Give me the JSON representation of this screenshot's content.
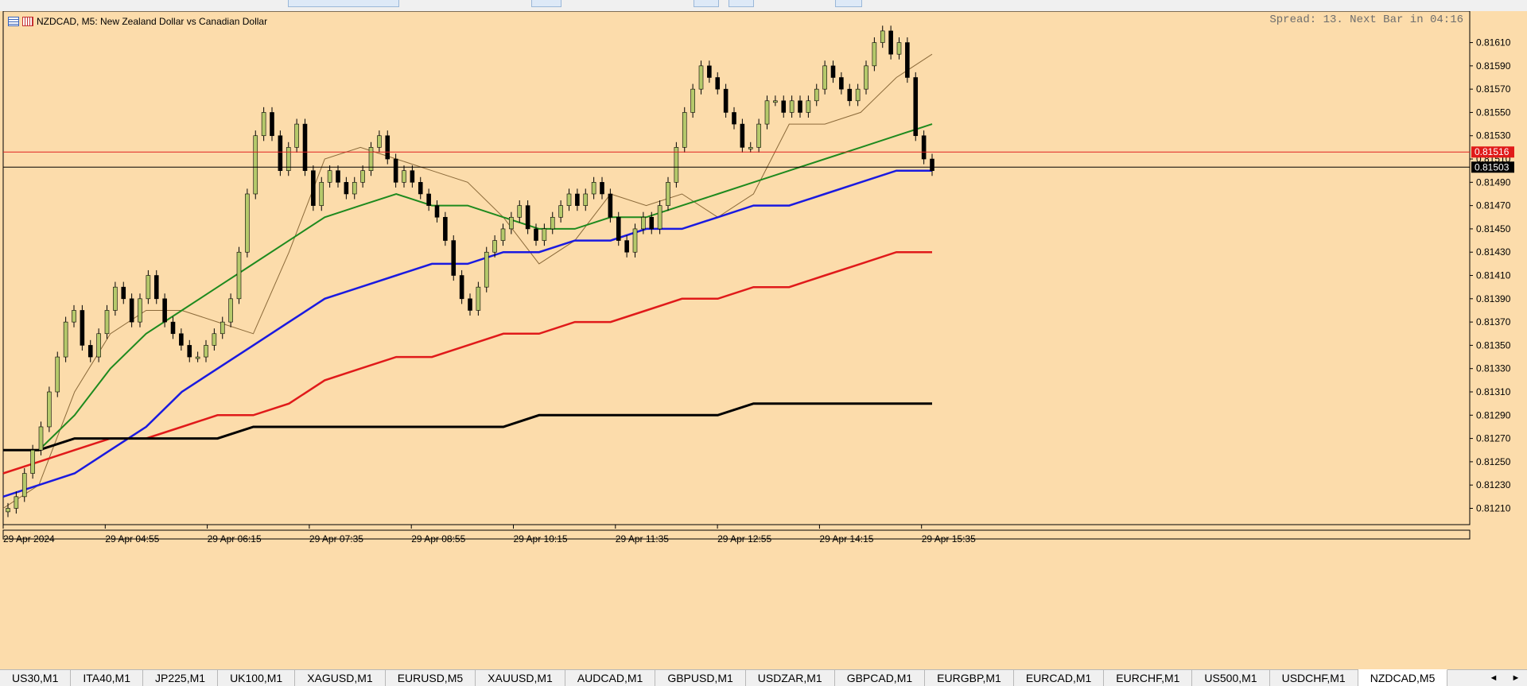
{
  "window": {
    "symbol_title": "NZDCAD, M5:  New Zealand Dollar vs Canadian Dollar",
    "spread_text": "Spread: 13. Next Bar in 04:16"
  },
  "icons": [
    "list-icon",
    "bar-chart-icon",
    "scroll-left-icon",
    "scroll-right-icon"
  ],
  "colors": {
    "chart_background": "#fcdcab",
    "bull_candle": "#b5c96b",
    "bear_candle": "#000000",
    "ask_line": "#e02020",
    "bid_line": "#000000"
  },
  "chart_data": {
    "type": "candlestick",
    "symbol": "NZDCAD",
    "timeframe": "M5",
    "x_ticks": [
      "29 Apr 2024",
      "29 Apr 04:55",
      "29 Apr 06:15",
      "29 Apr 07:35",
      "29 Apr 08:55",
      "29 Apr 10:15",
      "29 Apr 11:35",
      "29 Apr 12:55",
      "29 Apr 14:15",
      "29 Apr 15:35"
    ],
    "y_ticks": [
      "0.81610",
      "0.81590",
      "0.81570",
      "0.81550",
      "0.81530",
      "0.81510",
      "0.81490",
      "0.81470",
      "0.81450",
      "0.81430",
      "0.81410",
      "0.81390",
      "0.81370",
      "0.81350",
      "0.81330",
      "0.81310",
      "0.81290",
      "0.81270",
      "0.81250",
      "0.81230",
      "0.81210"
    ],
    "ylim": [
      0.81196,
      0.81637
    ],
    "ask_price": "0.81516",
    "bid_price": "0.81503",
    "closes": [
      0.8121,
      0.8122,
      0.8124,
      0.8126,
      0.8128,
      0.8131,
      0.8134,
      0.8137,
      0.8138,
      0.8135,
      0.8134,
      0.8136,
      0.8138,
      0.814,
      0.8139,
      0.8137,
      0.8139,
      0.8141,
      0.8139,
      0.8137,
      0.8136,
      0.8135,
      0.8134,
      0.8134,
      0.8135,
      0.8136,
      0.8137,
      0.8139,
      0.8143,
      0.8148,
      0.8153,
      0.8155,
      0.8153,
      0.815,
      0.8152,
      0.8154,
      0.815,
      0.8147,
      0.8149,
      0.815,
      0.8149,
      0.8148,
      0.8149,
      0.815,
      0.8152,
      0.8153,
      0.8151,
      0.8149,
      0.815,
      0.8149,
      0.8148,
      0.8147,
      0.8146,
      0.8144,
      0.8141,
      0.8139,
      0.8138,
      0.814,
      0.8143,
      0.8144,
      0.8145,
      0.8146,
      0.8147,
      0.8145,
      0.8144,
      0.8145,
      0.8146,
      0.8147,
      0.8148,
      0.8147,
      0.8148,
      0.8149,
      0.8148,
      0.8146,
      0.8144,
      0.8143,
      0.8145,
      0.8146,
      0.8145,
      0.8147,
      0.8149,
      0.8152,
      0.8155,
      0.8157,
      0.8159,
      0.8158,
      0.8157,
      0.8155,
      0.8154,
      0.8152,
      0.8152,
      0.8154,
      0.8156,
      0.8156,
      0.8155,
      0.8156,
      0.8155,
      0.8156,
      0.8157,
      0.8159,
      0.8158,
      0.8157,
      0.8156,
      0.8157,
      0.8159,
      0.8161,
      0.8162,
      0.816,
      0.8161,
      0.8158,
      0.8153,
      0.8151,
      0.815
    ],
    "series": [
      {
        "name": "",
        "values": [
          0.8121,
          0.8123,
          0.8131,
          0.8136,
          0.8138,
          0.8138,
          0.8137,
          0.8136,
          0.8143,
          0.8151,
          0.8152,
          0.8151,
          0.815,
          0.8149,
          0.8146,
          0.8142,
          0.8144,
          0.8148,
          0.8147,
          0.8148,
          0.8146,
          0.8148,
          0.8154,
          0.8154,
          0.8155,
          0.8158,
          0.816
        ]
      },
      {
        "name": "",
        "values": [
          0.8126,
          0.8126,
          0.8129,
          0.8133,
          0.8136,
          0.8138,
          0.814,
          0.8142,
          0.8144,
          0.8146,
          0.8147,
          0.8148,
          0.8147,
          0.8147,
          0.8146,
          0.8145,
          0.8145,
          0.8146,
          0.8146,
          0.8147,
          0.8148,
          0.8149,
          0.815,
          0.8151,
          0.8152,
          0.8153,
          0.8154
        ]
      },
      {
        "name": "",
        "values": [
          0.8122,
          0.8123,
          0.8124,
          0.8126,
          0.8128,
          0.8131,
          0.8133,
          0.8135,
          0.8137,
          0.8139,
          0.814,
          0.8141,
          0.8142,
          0.8142,
          0.8143,
          0.8143,
          0.8144,
          0.8144,
          0.8145,
          0.8145,
          0.8146,
          0.8147,
          0.8147,
          0.8148,
          0.8149,
          0.815,
          0.815
        ]
      },
      {
        "name": "",
        "values": [
          0.8124,
          0.8125,
          0.8126,
          0.8127,
          0.8127,
          0.8128,
          0.8129,
          0.8129,
          0.813,
          0.8132,
          0.8133,
          0.8134,
          0.8134,
          0.8135,
          0.8136,
          0.8136,
          0.8137,
          0.8137,
          0.8138,
          0.8139,
          0.8139,
          0.814,
          0.814,
          0.8141,
          0.8142,
          0.8143,
          0.8143
        ]
      },
      {
        "name": "",
        "values": [
          0.8126,
          0.8126,
          0.8127,
          0.8127,
          0.8127,
          0.8127,
          0.8127,
          0.8128,
          0.8128,
          0.8128,
          0.8128,
          0.8128,
          0.8128,
          0.8128,
          0.8128,
          0.8129,
          0.8129,
          0.8129,
          0.8129,
          0.8129,
          0.8129,
          0.813,
          0.813,
          0.813,
          0.813,
          0.813,
          0.813
        ]
      }
    ]
  },
  "tabs": [
    {
      "label": "US30,M1",
      "active": false
    },
    {
      "label": "ITA40,M1",
      "active": false
    },
    {
      "label": "JP225,M1",
      "active": false
    },
    {
      "label": "UK100,M1",
      "active": false
    },
    {
      "label": "XAGUSD,M1",
      "active": false
    },
    {
      "label": "EURUSD,M5",
      "active": false
    },
    {
      "label": "XAUUSD,M1",
      "active": false
    },
    {
      "label": "AUDCAD,M1",
      "active": false
    },
    {
      "label": "GBPUSD,M1",
      "active": false
    },
    {
      "label": "USDZAR,M1",
      "active": false
    },
    {
      "label": "GBPCAD,M1",
      "active": false
    },
    {
      "label": "EURGBP,M1",
      "active": false
    },
    {
      "label": "EURCAD,M1",
      "active": false
    },
    {
      "label": "EURCHF,M1",
      "active": false
    },
    {
      "label": "US500,M1",
      "active": false
    },
    {
      "label": "USDCHF,M1",
      "active": false
    },
    {
      "label": "NZDCAD,M5",
      "active": true
    }
  ],
  "scroll": {
    "left": "◄",
    "right": "►"
  }
}
